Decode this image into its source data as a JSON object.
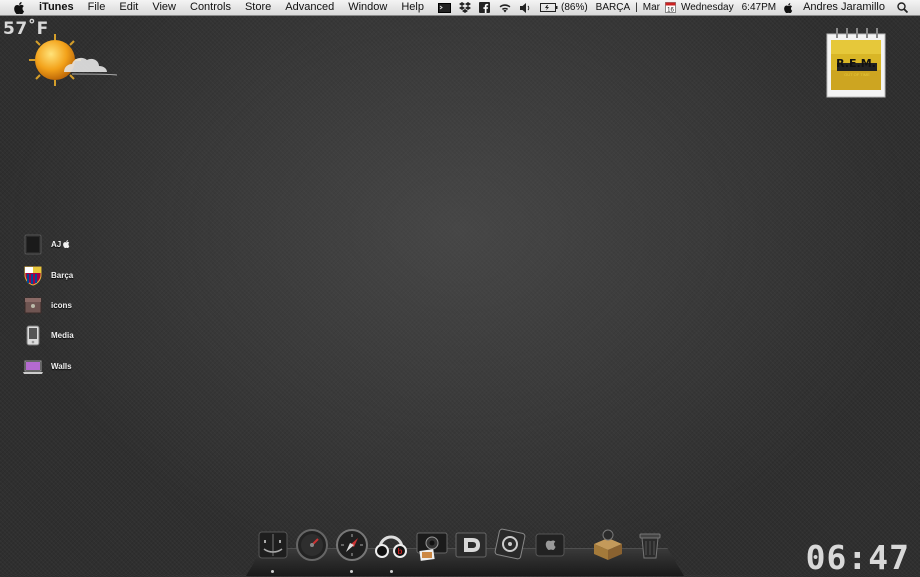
{
  "menubar": {
    "apple_icon": "apple-icon",
    "app_name": "iTunes",
    "menus": [
      "File",
      "Edit",
      "View",
      "Controls",
      "Store",
      "Advanced",
      "Window",
      "Help"
    ],
    "status": {
      "battery": "(86%)",
      "team": "BARÇA",
      "month": "Mar",
      "cal_day": "16",
      "weekday": "Wednesday",
      "time": "6:47PM",
      "user": "Andres Jaramillo"
    }
  },
  "weather": {
    "temperature": "57˚F",
    "icon": "sun-cloud-icon"
  },
  "album": {
    "band": "R.E.M.",
    "subtitle": "Out of Time"
  },
  "desktop_items": [
    {
      "label": "AJ ",
      "icon": "drive-icon"
    },
    {
      "label": "Barça",
      "icon": "fcb-crest-icon"
    },
    {
      "label": "icons",
      "icon": "box-icon"
    },
    {
      "label": "Media",
      "icon": "media-icon"
    },
    {
      "label": "Walls",
      "icon": "laptop-icon"
    }
  ],
  "dock": {
    "items": [
      "finder-icon",
      "dashboard-icon",
      "safari-icon",
      "beats-headphones-icon",
      "photo-booth-icon",
      "app-icon",
      "textmate-icon",
      "apple-box-icon",
      "downloads-box-icon",
      "trash-icon"
    ]
  },
  "colors": {
    "background": "#2f2f2f",
    "text_light": "#d9d9d9"
  },
  "clock": {
    "time": "06:47"
  }
}
